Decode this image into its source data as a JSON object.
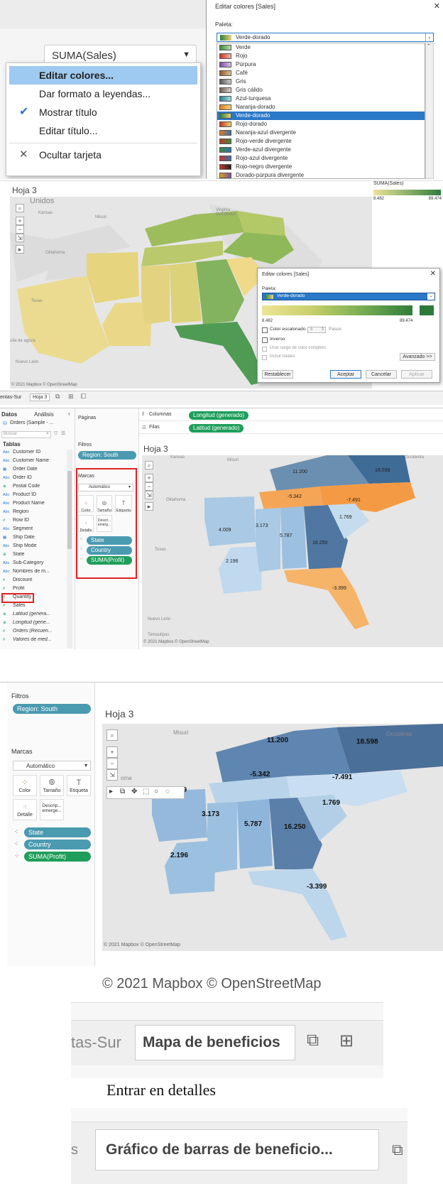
{
  "s1": {
    "measure": "SUMA(Sales)",
    "menu": [
      "Editar colores...",
      "Dar formato a leyendas...",
      "Mostrar título",
      "Editar título...",
      "Ocultar tarjeta"
    ],
    "dialog_title": "Editar colores [Sales]",
    "paleta_label": "Paleta:",
    "selected": "Verde-dorado",
    "palettes": [
      "Verde",
      "Rojo",
      "Púrpura",
      "Café",
      "Gris",
      "Gris cálido",
      "Azul-turquesa",
      "Naranja-dorado",
      "Verde-dorado",
      "Rojo-dorado",
      "Naranja-azul divergente",
      "Rojo-verde divergente",
      "Verde-azul divergente",
      "Rojo-azul divergente",
      "Rojo-negro divergente",
      "Dorado-púrpura divergente"
    ],
    "palette_colors": [
      [
        "#3d8a3d",
        "#b8dcaa"
      ],
      [
        "#c0392b",
        "#f3b3a6"
      ],
      [
        "#7b4ea0",
        "#d4c1e4"
      ],
      [
        "#8c5a2b",
        "#e0c29a"
      ],
      [
        "#555",
        "#ccc"
      ],
      [
        "#6b5e55",
        "#d8d0c8"
      ],
      [
        "#2a7f8a",
        "#a8dde0"
      ],
      [
        "#e07b20",
        "#f7d47a"
      ],
      [
        "#2f7d3b",
        "#e9d27a"
      ],
      [
        "#c0392b",
        "#f2d36b"
      ],
      [
        "#e07b20",
        "#3a6fb0"
      ],
      [
        "#c0392b",
        "#3d8a3d"
      ],
      [
        "#3d8a3d",
        "#3a6fb0"
      ],
      [
        "#c0392b",
        "#3a6fb0"
      ],
      [
        "#c0392b",
        "#222"
      ],
      [
        "#d4a020",
        "#7b4ea0"
      ]
    ]
  },
  "s2": {
    "sheet": "Hoja 3",
    "map_label_unidos": "Unidos",
    "map_labels": [
      "Kansas",
      "Misuri",
      "Oklahoma",
      "Texas",
      "Virginia Occidental",
      "Nuevo León",
      "uila de agoza"
    ],
    "legend_title": "SUMA(Sales)",
    "legend_min": "8.482",
    "legend_max": "89.474",
    "credit": "© 2021 Mapbox © OpenStreetMap",
    "dialog_title": "Editar colores [Sales]",
    "paleta_label": "Paleta:",
    "selected": "Verde-dorado",
    "min": "8.482",
    "max": "89.474",
    "stepped": "Color escalonado",
    "steps_value": "5",
    "steps_label": "Pasos",
    "inverse": "Inverso",
    "full_range": "Usar rango de color completo",
    "include_totals": "Incluir totales",
    "advanced": "Avanzado >>",
    "reset": "Restablecer",
    "ok": "Aceptar",
    "cancel": "Cancelar",
    "apply": "Aplicar",
    "tabs": [
      "entas-Sur",
      "Hoja 3"
    ]
  },
  "s3": {
    "data_tab": "Datos",
    "analysis_tab": "Análisis",
    "source": "Orders (Sample - ...",
    "search_placeholder": "Buscar",
    "tables_label": "Tablas",
    "fields": [
      {
        "t": "Abc",
        "n": "Customer ID"
      },
      {
        "t": "Abc",
        "n": "Customer Name"
      },
      {
        "t": "date",
        "n": "Order Date"
      },
      {
        "t": "Abc",
        "n": "Order ID"
      },
      {
        "t": "geo",
        "n": "Postal Code"
      },
      {
        "t": "Abc",
        "n": "Product ID"
      },
      {
        "t": "Abc",
        "n": "Product Name"
      },
      {
        "t": "Abc",
        "n": "Region"
      },
      {
        "t": "#",
        "n": "Row ID"
      },
      {
        "t": "Abc",
        "n": "Segment"
      },
      {
        "t": "date",
        "n": "Ship Date"
      },
      {
        "t": "Abc",
        "n": "Ship Mode"
      },
      {
        "t": "geo",
        "n": "State"
      },
      {
        "t": "Abc",
        "n": "Sub-Category"
      },
      {
        "t": "Abc",
        "n": "Nombres de m..."
      },
      {
        "t": "#",
        "n": "Discount"
      },
      {
        "t": "#",
        "n": "Profit"
      },
      {
        "t": "#",
        "n": "Quantity"
      },
      {
        "t": "#",
        "n": "Sales"
      },
      {
        "t": "geo",
        "n": "Latitud (genera..."
      },
      {
        "t": "geo",
        "n": "Longitud (gene..."
      },
      {
        "t": "#",
        "n": "Orders (Recuen..."
      },
      {
        "t": "#",
        "n": "Valores de med..."
      }
    ],
    "pages": "Páginas",
    "columns": "Columnas",
    "rows": "Filas",
    "col_pill": "Longitud (generado)",
    "row_pill": "Latitud (generado)",
    "filters": "Filtros",
    "filter_pill": "Region: South",
    "marks": "Marcas",
    "mark_type": "Automático",
    "color": "Color",
    "size": "Tamaño",
    "label": "Etiqueta",
    "detail": "Detalle",
    "tooltip": "Descri... emerg...",
    "mark_pills": [
      "State",
      "Country",
      "SUMA(Profit)"
    ],
    "sheet": "Hoja 3",
    "values": [
      "11.200",
      "18.598",
      "-5.342",
      "-7.491",
      "4.009",
      "3.173",
      "5.787",
      "1.769",
      "16.250",
      "2.196",
      "-3.399"
    ],
    "map_labels": [
      "Kansas",
      "Misuri",
      "Oklahoma",
      "Texas",
      "Tamaulipas",
      "Nuevo León",
      "Occidenta"
    ],
    "credit": "© 2021 Mapbox © OpenStreetMap"
  },
  "s4": {
    "filters": "Filtros",
    "filter_pill": "Region: South",
    "marks": "Marcas",
    "mark_type": "Automático",
    "color": "Color",
    "size": "Tamaño",
    "label": "Etiqueta",
    "detail": "Detalle",
    "tooltip": "Descrip... emerge...",
    "mark_pills": [
      "State",
      "Country",
      "SUMA(Profit)"
    ],
    "sheet": "Hoja 3",
    "values": [
      "11.200",
      "18.598",
      "-5.342",
      "-7.491",
      "09",
      "3.173",
      "5.787",
      "1.769",
      "16.250",
      "2.196",
      "-3.399"
    ],
    "map_labels": [
      "Misuri",
      "Occidenta",
      "oma"
    ],
    "credit": "© 2021 Mapbox © OpenStreetMap"
  },
  "s5": {
    "credit": "© 2021 Mapbox © OpenStreetMap",
    "tab_left": "tas-Sur",
    "tab_active": "Mapa de beneficios"
  },
  "caption": "Entrar en detalles",
  "s6": {
    "tab_left": "s",
    "tab_active": "Gráfico de barras de beneficio..."
  }
}
